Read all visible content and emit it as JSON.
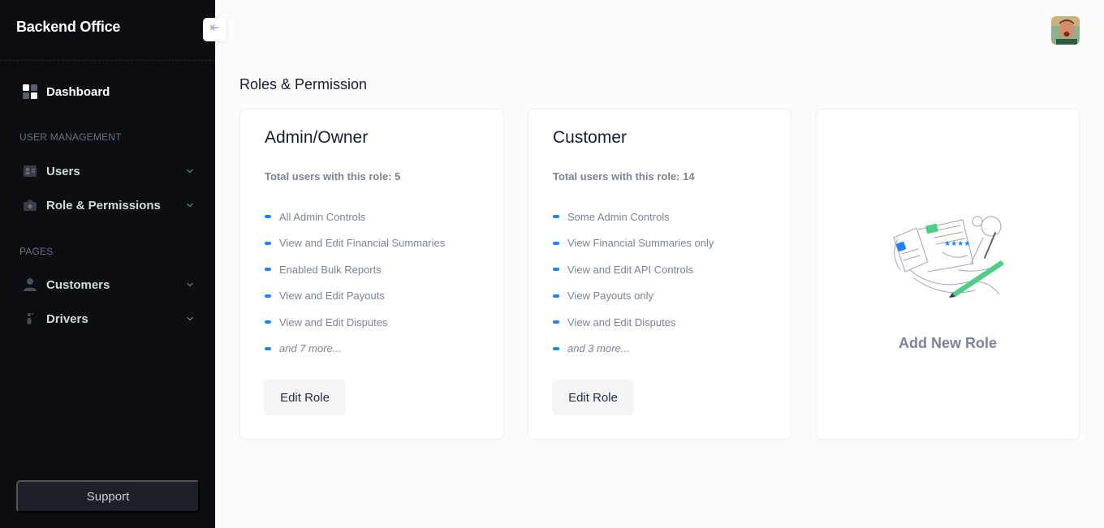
{
  "app": {
    "title": "Backend Office"
  },
  "sidebar": {
    "dashboard": {
      "label": "Dashboard",
      "icon": "dashboard-icon"
    },
    "sections": [
      {
        "label": "USER MANAGEMENT"
      },
      {
        "label": "PAGES"
      }
    ],
    "items": [
      {
        "label": "Users",
        "icon": "users-icon"
      },
      {
        "label": "Role & Permissions",
        "icon": "role-icon"
      },
      {
        "label": "Customers",
        "icon": "customer-icon"
      },
      {
        "label": "Drivers",
        "icon": "driver-icon"
      }
    ],
    "support_label": "Support"
  },
  "main": {
    "title": "Roles & Permission",
    "roles": [
      {
        "name": "Admin/Owner",
        "users_text": "Total users with this role: 5",
        "permissions": [
          "All Admin Controls",
          "View and Edit Financial Summaries",
          "Enabled Bulk Reports",
          "View and Edit Payouts",
          "View and Edit Disputes"
        ],
        "more": "and 7 more...",
        "edit_label": "Edit Role"
      },
      {
        "name": "Customer",
        "users_text": "Total users with this role: 14",
        "permissions": [
          "Some Admin Controls",
          "View Financial Summaries only",
          "View and Edit API Controls",
          "View Payouts only",
          "View and Edit Disputes"
        ],
        "more": "and 3 more...",
        "edit_label": "Edit Role"
      }
    ],
    "add_role_label": "Add New Role"
  },
  "colors": {
    "sidebar_bg": "#0d0e12",
    "accent": "#1b84ff",
    "text_muted": "#7e8299",
    "text_dark": "#181c32"
  }
}
